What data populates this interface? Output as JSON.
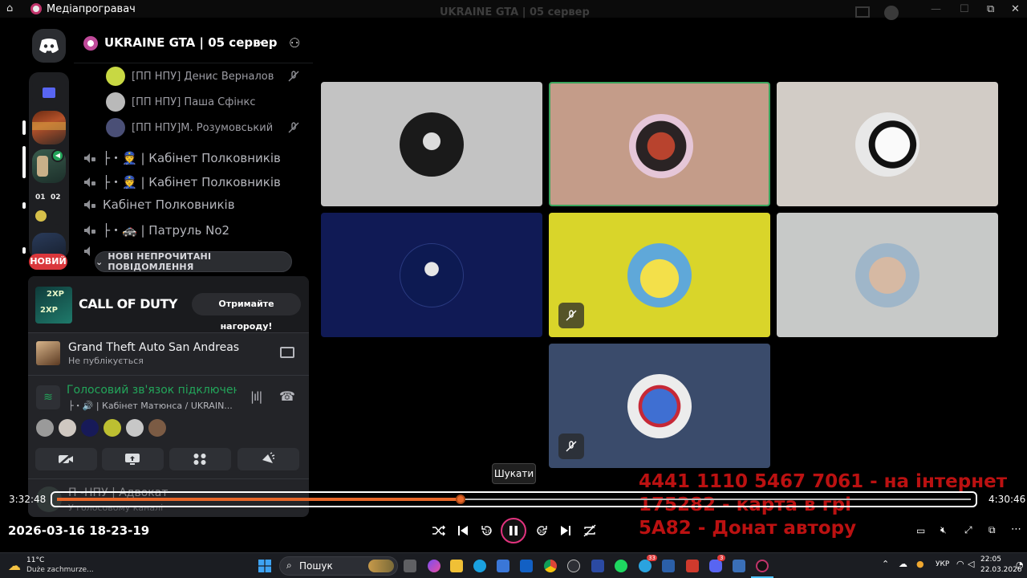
{
  "titlebar": {
    "app_title": "Медіапрогравач",
    "window_title": "UKRAINE GTA | 05 сервер"
  },
  "sidebar": {
    "new_badge": "НОВИЙ",
    "server_tile_labels": [
      "01",
      "02"
    ]
  },
  "channels": {
    "server_name": "UKRAINE GTA | 05 сервер",
    "members": [
      {
        "name": "[ПП НПУ] Денис Верналов",
        "muted": true
      },
      {
        "name": "[ПП НПУ] Паша Сфінкс",
        "muted": false
      },
      {
        "name": "[ПП НПУ]М. Розумовський",
        "muted": true
      }
    ],
    "voice_channels": [
      "├・👮 | Кабінет Полковників",
      "├・👮 | Кабінет Полковників",
      "Кабінет Полковників",
      "├・🚓 | Патруль No2"
    ],
    "unread_label": "НОВІ НЕПРОЧИТАНІ ПОВІДОМЛЕННЯ"
  },
  "user_panel": {
    "cod_logo": "CALL OF DUTY",
    "cod_xp": "2XP",
    "reward_button": "Отримайте нагороду!",
    "game_title": "Grand Theft Auto San Andreas",
    "game_status": "Не публікується",
    "voice_status": "Голосовий зв'язок підключено",
    "voice_channel": "├・🔊 | Кабінет Матюнса / UKRAIN...",
    "hidden_user": "П -НПУ | Адвокат",
    "hidden_user_status": "У голосовому каналі"
  },
  "player": {
    "overlay_lines": [
      "4441 1110 5467 7061 - на інтернет",
      "175282 - карта в грі",
      "5А82 - Донат автору"
    ],
    "seek_tooltip": "Шукати",
    "time_elapsed": "3:32:48",
    "time_total": "4:30:46",
    "progress": 0.442,
    "recording_timestamp": "2026-03-16 18-23-19"
  },
  "taskbar": {
    "weather_temp": "11°C",
    "weather_desc": "Duże zachmurze...",
    "search_label": "Пошук",
    "lang": "УКР",
    "clock_time": "22:05",
    "clock_date": "22.03.2026",
    "discord_badge": "3",
    "telegram_badge": "33"
  },
  "colors": {
    "discord_blurple": "#5865f2",
    "voice_green": "#23a55a",
    "speaking_border": "#3ba55d",
    "seek_orange": "#e8672a",
    "overlay_red": "#dc1414"
  }
}
